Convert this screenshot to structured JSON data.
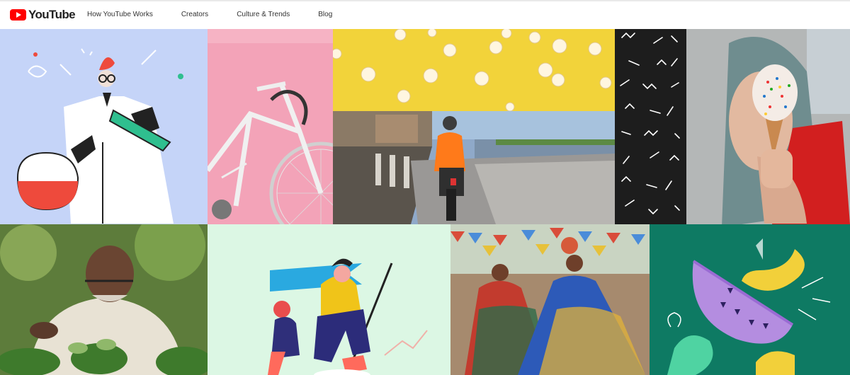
{
  "brand": {
    "name": "YouTube",
    "icon": "youtube-play-icon",
    "color": "#ff0000"
  },
  "nav": [
    {
      "label": "How YouTube Works"
    },
    {
      "label": "Creators"
    },
    {
      "label": "Culture & Trends"
    },
    {
      "label": "Blog"
    }
  ],
  "tiles": [
    {
      "id": "scientist-illustration",
      "bg": "#c5d4f8"
    },
    {
      "id": "pink-bicycle-photo",
      "bg": "#f3a3b8"
    },
    {
      "id": "popcorn-yellow-photo",
      "bg": "#f2d33a"
    },
    {
      "id": "motorbike-river-photo",
      "bg": "#6b7f95"
    },
    {
      "id": "squiggle-pattern",
      "bg": "#1d1d1d"
    },
    {
      "id": "ice-cream-photo",
      "bg": "#b4b7b7"
    },
    {
      "id": "gardener-photo",
      "bg": "#6a8a43"
    },
    {
      "id": "hikers-illustration",
      "bg": "#dcf7e4"
    },
    {
      "id": "dancers-photo",
      "bg": "#a68a6e"
    },
    {
      "id": "fruit-illustration",
      "bg": "#0e7a63"
    }
  ]
}
